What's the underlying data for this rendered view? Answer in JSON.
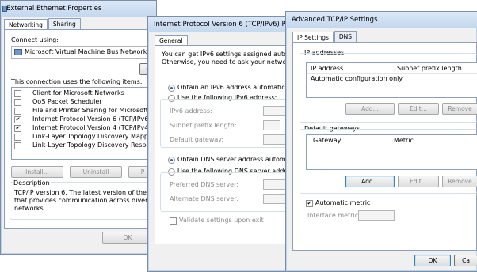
{
  "eth": {
    "title": "External Ethernet Properties",
    "tabs": [
      "Networking",
      "Sharing"
    ],
    "connect_using_label": "Connect using:",
    "adapter": "Microsoft Virtual Machine Bus Network Adapter",
    "configure_btn": "C",
    "items_label": "This connection uses the following items:",
    "items": [
      {
        "label": "Client for Microsoft Networks",
        "checked": false
      },
      {
        "label": "QoS Packet Scheduler",
        "checked": false
      },
      {
        "label": "File and Printer Sharing for Microsoft Network",
        "checked": false
      },
      {
        "label": "Internet Protocol Version 6 (TCP/IPv6)",
        "checked": true
      },
      {
        "label": "Internet Protocol Version 4 (TCP/IPv4)",
        "checked": true
      },
      {
        "label": "Link-Layer Topology Discovery Mapper I/O D",
        "checked": false
      },
      {
        "label": "Link-Layer Topology Discovery Responder",
        "checked": false
      }
    ],
    "install_btn": "Install...",
    "uninstall_btn": "Uninstall",
    "properties_btn": "P",
    "description_label": "Description",
    "description_text": "TCP/IP version 6. The latest version of the internet\nthat provides communication across diverse interco\nnetworks.",
    "ok_btn": "OK"
  },
  "ipv6": {
    "title": "Internet Protocol Version 6 (TCP/IPv6) Properti",
    "tab": "General",
    "intro": "You can get IPv6 settings assigned automaticall\nOtherwise, you need to ask your network admi",
    "obtain_auto": "Obtain an IPv6 address automatically",
    "use_following": "Use the following IPv6 address:",
    "ipv6_address_label": "IPv6 address:",
    "prefix_label": "Subnet prefix length:",
    "gateway_label": "Default gateway:",
    "dns_auto": "Obtain DNS server address automatically",
    "dns_use_following": "Use the following DNS server addresses:",
    "preferred_dns_label": "Preferred DNS server:",
    "alternate_dns_label": "Alternate DNS server:",
    "validate_label": "Validate settings upon exit"
  },
  "adv": {
    "title": "Advanced TCP/IP Settings",
    "tabs": [
      "IP Settings",
      "DNS"
    ],
    "ip_group_label": "IP addresses",
    "ip_col1": "IP address",
    "ip_col2": "Subnet prefix length",
    "ip_row": "Automatic configuration only",
    "add_btn": "Add...",
    "edit_btn": "Edit...",
    "remove_btn": "Remove",
    "gw_group_label": "Default gateways:",
    "gw_col1": "Gateway",
    "gw_col2": "Metric",
    "add2_btn": "Add...",
    "edit2_btn": "Edit...",
    "remove2_btn": "Remove",
    "auto_metric_label": "Automatic metric",
    "interface_metric_label": "Interface metric:",
    "ok_btn": "OK",
    "cancel_btn": "Ca"
  }
}
